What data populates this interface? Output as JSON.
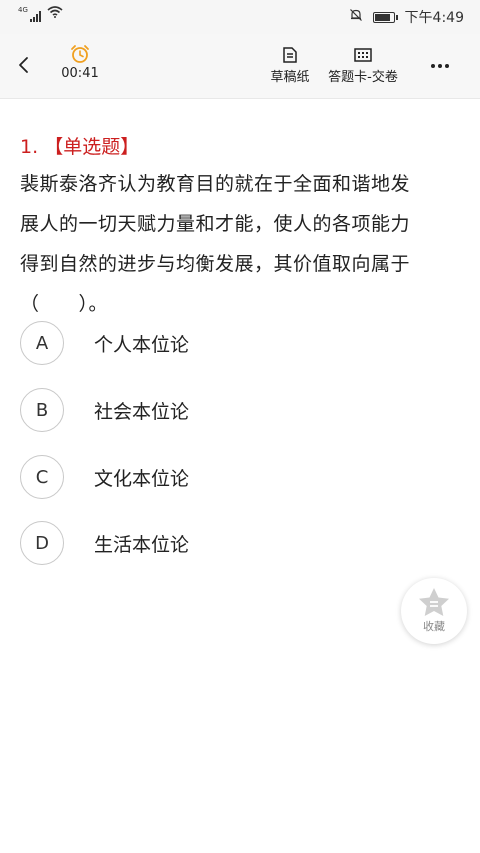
{
  "status_bar": {
    "network": "4G",
    "time": "下午4:49"
  },
  "header": {
    "timer": "00:41",
    "draft_label": "草稿纸",
    "answer_sheet_label": "答题卡-交卷"
  },
  "question": {
    "number": "1.",
    "type": "【单选题】",
    "lines": [
      "裴斯泰洛齐认为教育目的就在于全面和谐地发",
      "展人的一切天赋力量和才能，使人的各项能力",
      "得到自然的进步与均衡发展，其价值取向属于",
      "（　　）。"
    ]
  },
  "options": [
    {
      "letter": "A",
      "text": "个人本位论"
    },
    {
      "letter": "B",
      "text": "社会本位论"
    },
    {
      "letter": "C",
      "text": "文化本位论"
    },
    {
      "letter": "D",
      "text": "生活本位论"
    }
  ],
  "favorite": {
    "label": "收藏"
  },
  "colors": {
    "accent_red": "#cc1f1f",
    "timer_orange": "#f0a020",
    "header_bg": "#f7f7f7"
  }
}
